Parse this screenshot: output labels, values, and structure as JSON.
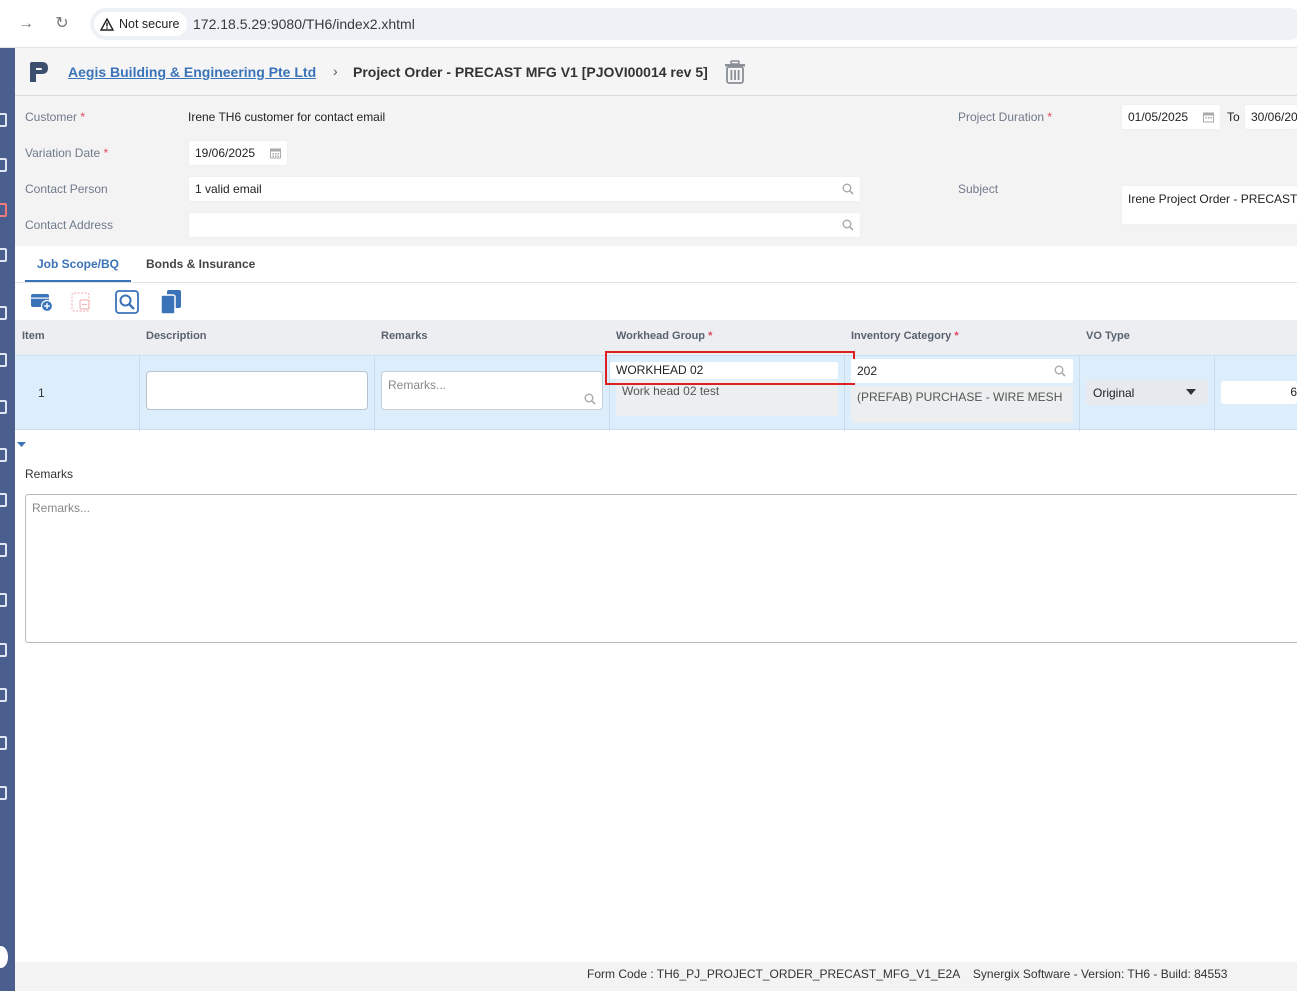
{
  "browser": {
    "security_label": "Not secure",
    "url": "172.18.5.29:9080/TH6/index2.xhtml"
  },
  "header": {
    "company": "Aegis Building & Engineering Pte Ltd",
    "separator": "›",
    "title": "Project Order - PRECAST MFG V1 [PJOVI00014 rev 5]"
  },
  "form": {
    "customer_label": "Customer",
    "customer_value": "Irene TH6 customer for contact email",
    "variation_date_label": "Variation Date",
    "variation_date_value": "19/06/2025",
    "contact_person_label": "Contact Person",
    "contact_person_value": "1 valid email",
    "contact_address_label": "Contact Address",
    "contact_address_value": "",
    "project_duration_label": "Project Duration",
    "duration_from": "01/05/2025",
    "duration_to_label": "To",
    "duration_to": "30/06/20",
    "subject_label": "Subject",
    "subject_value": "Irene Project Order - PRECAST",
    "required_mark": "*"
  },
  "tabs": [
    {
      "label": "Job Scope/BQ",
      "active": true
    },
    {
      "label": "Bonds & Insurance",
      "active": false
    }
  ],
  "toolbar": {
    "icons": [
      "add-row-icon",
      "delete-row-icon",
      "search-icon",
      "copy-icon"
    ]
  },
  "grid": {
    "columns": [
      "Item",
      "Description",
      "Remarks",
      "Workhead Group",
      "Inventory Category",
      "VO Type"
    ],
    "rows": [
      {
        "item": "1",
        "description": "",
        "remarks_placeholder": "Remarks...",
        "workhead_group": "WORKHEAD 02",
        "workhead_desc": "Work head 02 test",
        "inventory_category": "202",
        "inventory_desc": "(PREFAB) PURCHASE - WIRE MESH",
        "vo_type": "Original",
        "next_value": "6"
      }
    ]
  },
  "remarks": {
    "label": "Remarks",
    "placeholder": "Remarks..."
  },
  "footer": {
    "text": "Form Code : TH6_PJ_PROJECT_ORDER_PRECAST_MFG_V1_E2A    Synergix Software - Version: TH6 - Build: 84553"
  },
  "colors": {
    "accent": "#3b73b9",
    "rail": "#4a5f8d",
    "row_highlight": "#dcedfc",
    "focus_border": "#e02020",
    "required": "#e0455a"
  }
}
